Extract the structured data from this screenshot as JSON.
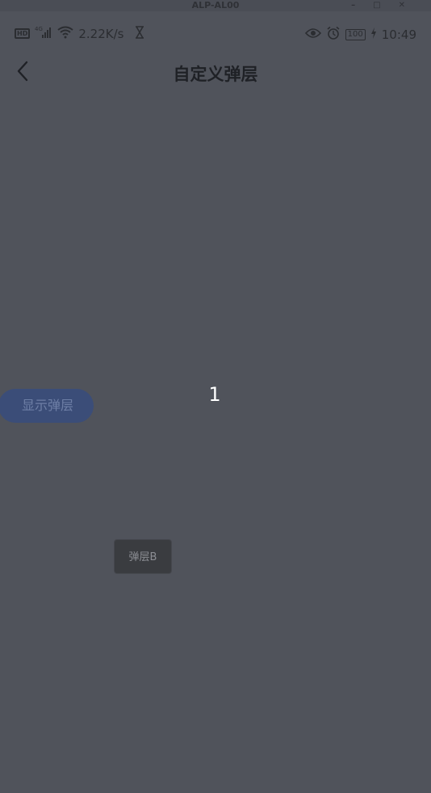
{
  "window": {
    "title": "ALP-AL00",
    "controls": [
      "–",
      "□",
      "✕"
    ]
  },
  "status_bar": {
    "network_speed": "2.22K/s",
    "hd_badge": "HD",
    "cell_generation": "4G",
    "battery": "100",
    "time": "10:49",
    "icons": [
      "hd-icon",
      "signal-icon",
      "wifi-icon",
      "hourglass-icon",
      "eye-icon",
      "alarm-icon",
      "battery-icon",
      "charging-icon"
    ]
  },
  "nav": {
    "title": "自定义弹层",
    "back_icon": "chevron-left-icon"
  },
  "main": {
    "show_layer_button": "显示弹层",
    "counter": "1",
    "layer_b_label": "弹层B"
  },
  "colors": {
    "background_dimmed": "#50535b",
    "button_blue_dimmed": "#3b4d78",
    "layer_box": "#3a3c40"
  }
}
